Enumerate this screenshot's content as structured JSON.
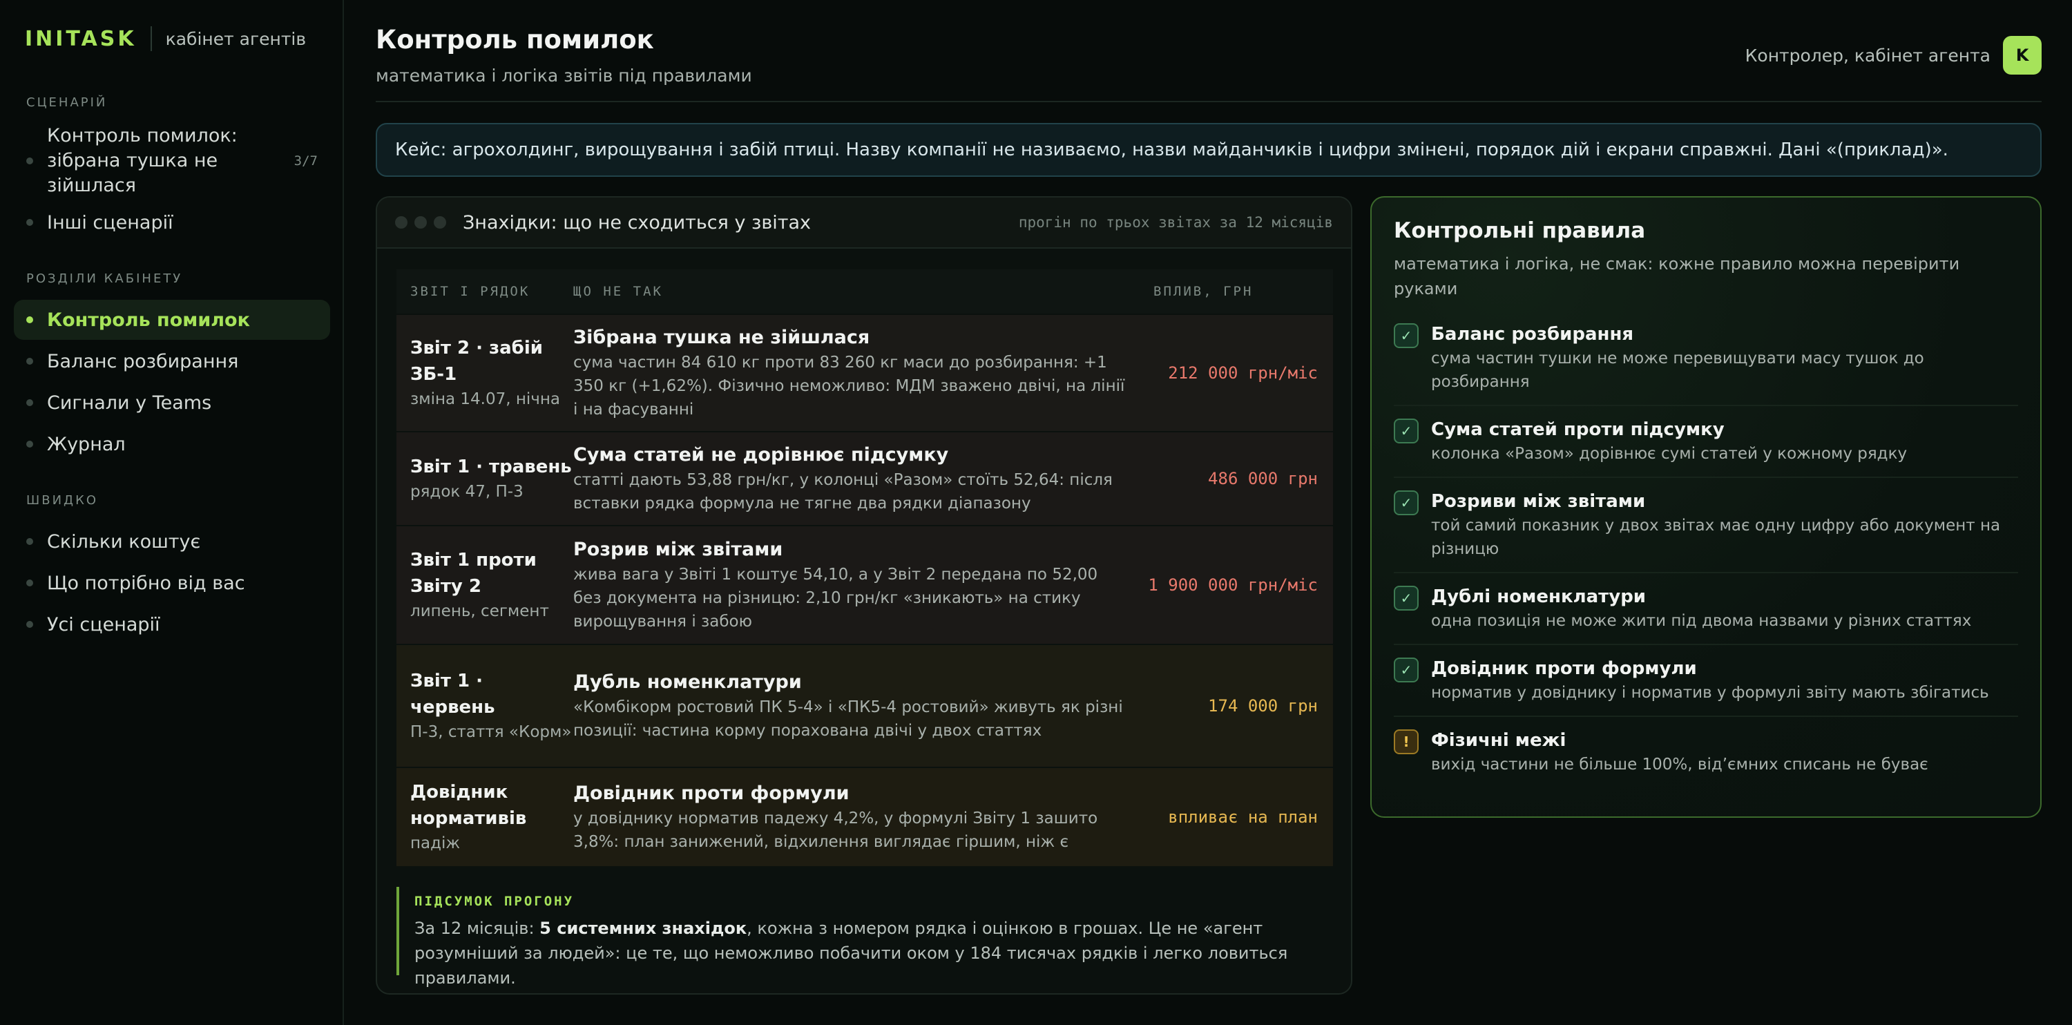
{
  "sidebar": {
    "brand": "INITASK",
    "brand_sub": "кабінет агентів",
    "sections": {
      "scenario": "СЦЕНАРІЙ",
      "cabinet": "РОЗДІЛИ КАБІНЕТУ",
      "quick": "ШВИДКО"
    },
    "scenario_items": [
      {
        "label": "Контроль помилок: зібрана тушка не зійшлася",
        "count": "3/7"
      },
      {
        "label": "Інші сценарії"
      }
    ],
    "cabinet_items": [
      {
        "label": "Контроль помилок",
        "active": true
      },
      {
        "label": "Баланс розбирання"
      },
      {
        "label": "Сигнали у Teams"
      },
      {
        "label": "Журнал"
      }
    ],
    "quick_items": [
      {
        "label": "Скільки коштує"
      },
      {
        "label": "Що потрібно від вас"
      },
      {
        "label": "Усі сценарії"
      }
    ]
  },
  "header": {
    "title": "Контроль помилок",
    "subtitle": "математика і логіка звітів під правилами",
    "user_label": "Контролер, кабінет агента",
    "avatar": "K"
  },
  "case_note": "Кейс: агрохолдинг, вирощування і забій птиці. Назву компанії не називаємо, назви майданчиків і цифри змінені, порядок дій і екрани справжні. Дані «(приклад)».",
  "findings": {
    "title": "Знахідки: що не сходиться у звітах",
    "meta": "прогін по трьох звітах за 12 місяців",
    "columns": [
      "ЗВІТ І РЯДОК",
      "ЩО НЕ ТАК",
      "ВПЛИВ, ГРН"
    ],
    "rows": [
      {
        "report": "Звіт 2 · забій ЗБ-1",
        "ref": "зміна 14.07, нічна",
        "title": "Зібрана тушка не зійшлася",
        "desc": "сума частин 84 610 кг проти 83 260 кг маси до розбирання: +1 350 кг (+1,62%). Фізично неможливо: МДМ зважено двічі, на лінії і на фасуванні",
        "impact": "212 000 грн/міс",
        "tone": "red",
        "bg": "#1b1a17"
      },
      {
        "report": "Звіт 1 · травень",
        "ref": "рядок 47, П-3",
        "title": "Сума статей не дорівнює підсумку",
        "desc": "статті дають 53,88 грн/кг, у колонці «Разом» стоїть 52,64: після вставки рядка формула не тягне два рядки діапазону",
        "impact": "486 000 грн",
        "tone": "red",
        "bg": "#1b1917"
      },
      {
        "report": "Звіт 1 проти Звіту 2",
        "ref": "липень, сегмент",
        "title": "Розрив між звітами",
        "desc": "жива вага у Звіті 1 коштує 54,10, а у Звіт 2 передана по 52,00 без документа на різницю: 2,10 грн/кг «зникають» на стику вирощування і забою",
        "impact": "1 900 000 грн/міс",
        "tone": "red",
        "bg": "#1b1917"
      },
      {
        "report": "Звіт 1 · червень",
        "ref": "П-3, стаття «Корм»",
        "title": "Дубль номенклатури",
        "desc": "«Комбікорм ростовий ПК 5-4» і «ПК5-4 ростовий» живуть як різні позиції: частина корму порахована двічі у двох статтях",
        "impact": "174 000 грн",
        "tone": "amber",
        "bg": "#1c1c12"
      },
      {
        "report": "Довідник нормативів",
        "ref": "падіж",
        "title": "Довідник проти формули",
        "desc": "у довіднику норматив падежу 4,2%, у формулі Звіту 1 зашито 3,8%: план занижений, відхилення виглядає гіршим, ніж є",
        "impact": "впливає на план",
        "tone": "amber",
        "bg": "#1e1c11"
      }
    ],
    "summary_label": "ПІДСУМОК ПРОГОНУ",
    "summary_pre": "За 12 місяців: ",
    "summary_bold": "5 системних знахідок",
    "summary_post": ", кожна з номером рядка і оцінкою в грошах. Це не «агент розумніший за людей»: це те, що неможливо побачити оком у 184 тисячах рядків і легко ловиться правилами."
  },
  "rules": {
    "title": "Контрольні правила",
    "subtitle": "математика і логіка, не смак: кожне правило можна перевірити руками",
    "items": [
      {
        "title": "Баланс розбирання",
        "desc": "сума частин тушки не може перевищувати масу тушок до розбирання",
        "mark": "✓",
        "kind": "ok"
      },
      {
        "title": "Сума статей проти підсумку",
        "desc": "колонка «Разом» дорівнює сумі статей у кожному рядку",
        "mark": "✓",
        "kind": "ok"
      },
      {
        "title": "Розриви між звітами",
        "desc": "той самий показник у двох звітах має одну цифру або документ на різницю",
        "mark": "✓",
        "kind": "ok"
      },
      {
        "title": "Дублі номенклатури",
        "desc": "одна позиція не може жити під двома назвами у різних статтях",
        "mark": "✓",
        "kind": "ok"
      },
      {
        "title": "Довідник проти формули",
        "desc": "норматив у довіднику і норматив у формулі звіту мають збігатись",
        "mark": "✓",
        "kind": "ok"
      },
      {
        "title": "Фізичні межі",
        "desc": "вихід частини не більше 100%, від’ємних списань не буває",
        "mark": "!",
        "kind": "warn"
      }
    ]
  }
}
